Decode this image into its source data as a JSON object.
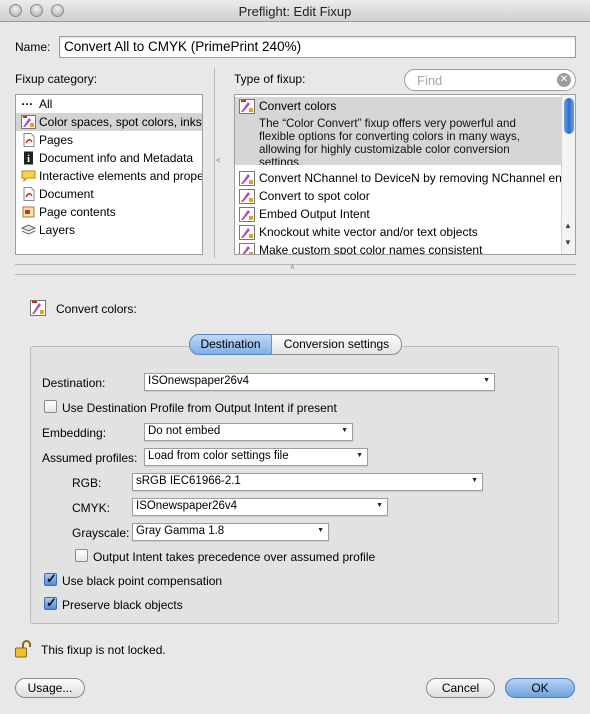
{
  "window": {
    "title": "Preflight: Edit Fixup"
  },
  "name": {
    "label": "Name:",
    "value": "Convert All to CMYK (PrimePrint 240%)"
  },
  "fixup_category": {
    "label": "Fixup category:",
    "items": [
      {
        "label": "All",
        "icon": "ellipsis-icon",
        "selected": false
      },
      {
        "label": "Color spaces, spot colors, inks",
        "icon": "color-tool-icon",
        "selected": true
      },
      {
        "label": "Pages",
        "icon": "pdf-page-icon",
        "selected": false
      },
      {
        "label": "Document info and Metadata",
        "icon": "info-icon",
        "selected": false
      },
      {
        "label": "Interactive elements and properties",
        "icon": "comment-icon",
        "selected": false
      },
      {
        "label": "Document",
        "icon": "pdf-document-icon",
        "selected": false
      },
      {
        "label": "Page contents",
        "icon": "page-contents-icon",
        "selected": false
      },
      {
        "label": "Layers",
        "icon": "layers-icon",
        "selected": false
      }
    ]
  },
  "type_of_fixup": {
    "label": "Type of fixup:",
    "search_placeholder": "Find",
    "items": [
      {
        "label": "Convert colors",
        "description": "The “Color Convert” fixup offers very powerful and flexible options for converting colors in many ways, allowing for highly customizable color conversion settings.",
        "selected": true
      },
      {
        "label": "Convert NChannel to DeviceN by removing NChannel entries",
        "selected": false
      },
      {
        "label": "Convert to spot color",
        "selected": false
      },
      {
        "label": "Embed Output Intent",
        "selected": false
      },
      {
        "label": "Knockout white vector and/or text objects",
        "selected": false
      },
      {
        "label": "Make custom spot color names consistent",
        "selected": false
      }
    ]
  },
  "section": {
    "title": "Convert colors:"
  },
  "tabs": {
    "destination": "Destination",
    "conversion": "Conversion settings"
  },
  "form": {
    "destination_label": "Destination:",
    "destination_value": "ISOnewspaper26v4",
    "use_dest_profile_label": "Use Destination Profile from Output Intent if present",
    "use_dest_profile_checked": false,
    "embedding_label": "Embedding:",
    "embedding_value": "Do not embed",
    "assumed_label": "Assumed profiles:",
    "assumed_value": "Load from color settings file",
    "rgb_label": "RGB:",
    "rgb_value": "sRGB IEC61966-2.1",
    "cmyk_label": "CMYK:",
    "cmyk_value": "ISOnewspaper26v4",
    "gray_label": "Grayscale:",
    "gray_value": "Gray Gamma 1.8",
    "output_intent_label": "Output Intent takes precedence over assumed profile",
    "output_intent_checked": false,
    "black_point_label": "Use black point compensation",
    "black_point_checked": true,
    "preserve_black_label": "Preserve black objects",
    "preserve_black_checked": true
  },
  "lock": {
    "text": "This fixup is not locked.",
    "icon": "unlock-icon"
  },
  "buttons": {
    "usage": "Usage...",
    "cancel": "Cancel",
    "ok": "OK"
  },
  "colors": {
    "accent": "#6ea0de",
    "selection": "#d4d4d4"
  }
}
